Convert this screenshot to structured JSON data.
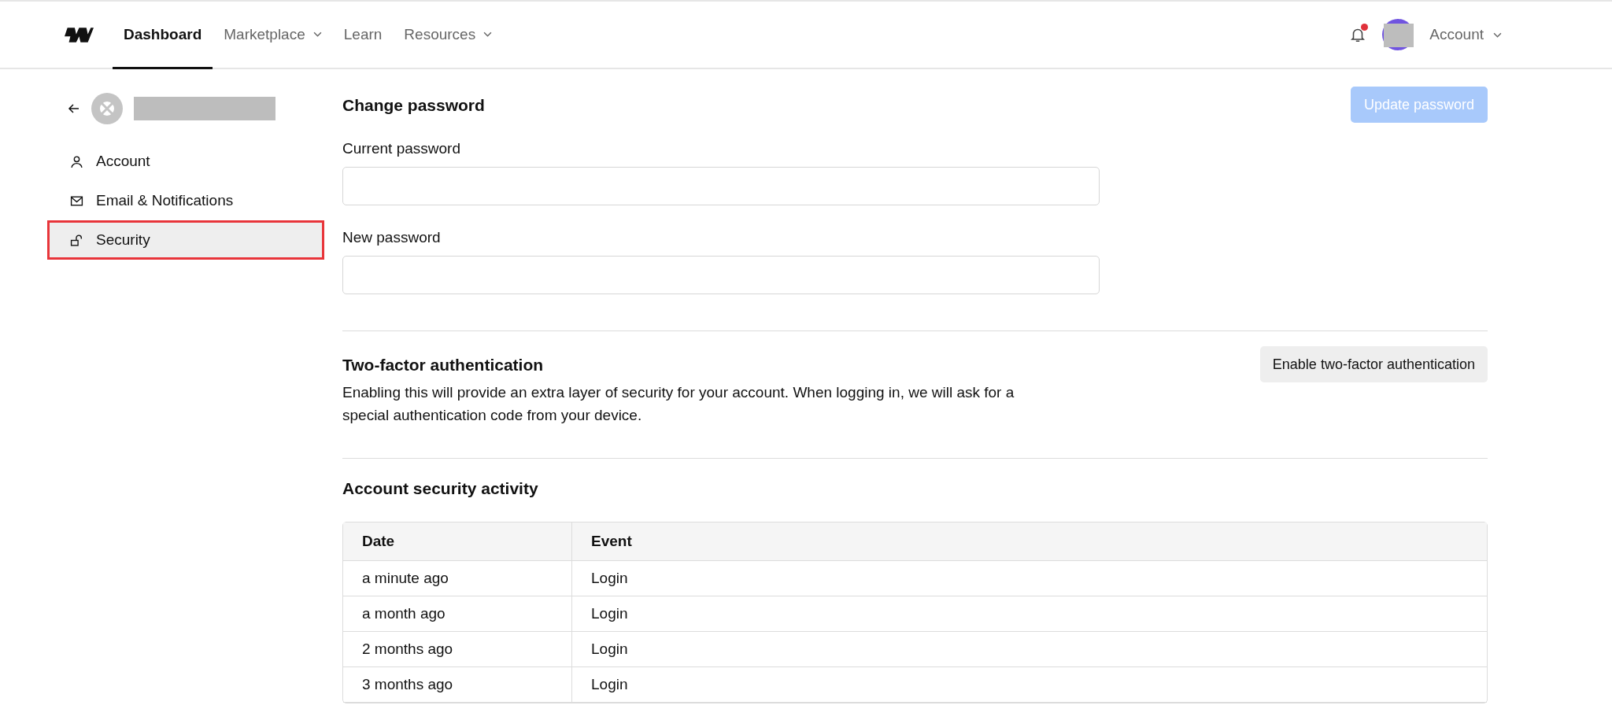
{
  "nav": {
    "items": [
      {
        "label": "Dashboard",
        "selected": true,
        "dropdown": false
      },
      {
        "label": "Marketplace",
        "selected": false,
        "dropdown": true
      },
      {
        "label": "Learn",
        "selected": false,
        "dropdown": false
      },
      {
        "label": "Resources",
        "selected": false,
        "dropdown": true
      }
    ],
    "notifications": {
      "unread": true
    },
    "account": {
      "label": "Account"
    }
  },
  "sidebar": {
    "items": [
      {
        "label": "Account",
        "kind": "person",
        "selected": false
      },
      {
        "label": "Email & Notifications",
        "kind": "mail",
        "selected": false
      },
      {
        "label": "Security",
        "kind": "lock",
        "selected": true
      }
    ]
  },
  "password": {
    "title": "Change password",
    "button": {
      "label": "Update password",
      "disabled": true
    },
    "fields": [
      {
        "label": "Current password"
      },
      {
        "label": "New password"
      }
    ]
  },
  "two_factor": {
    "title": "Two-factor authentication",
    "description": "Enabling this will provide an extra layer of security for your account. When logging in, we will ask for a special authentication code from your device.",
    "button": "Enable two-factor authentication"
  },
  "activity": {
    "title": "Account security activity",
    "columns": [
      "Date",
      "Event"
    ],
    "rows": [
      [
        "a minute ago",
        "Login"
      ],
      [
        "a month ago",
        "Login"
      ],
      [
        "2 months ago",
        "Login"
      ],
      [
        "3 months ago",
        "Login"
      ]
    ]
  }
}
